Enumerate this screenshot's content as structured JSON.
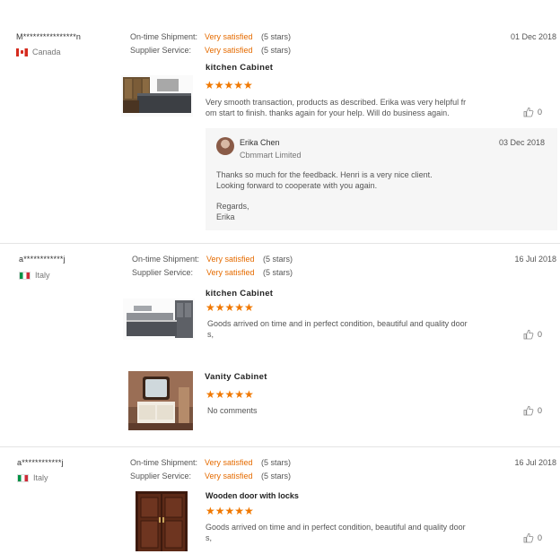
{
  "reviews": [
    {
      "user": "M****************n",
      "country": "Canada",
      "shipment_label": "On-time Shipment:",
      "shipment_value": "Very satisfied",
      "shipment_stars": "(5 stars)",
      "service_label": "Supplier Service:",
      "service_value": "Very satisfied",
      "service_stars": "(5 stars)",
      "date": "01 Dec 2018",
      "items": [
        {
          "title": "kitchen Cabinet",
          "stars": "★★★★★",
          "text_line1": "Very smooth transaction, products as described. Erika was very helpful fr",
          "text_line2": "om start to finish. thanks again for your help. Will do business again.",
          "likes": "0"
        }
      ],
      "reply": {
        "name": "Erika Chen",
        "company": "Cbmmart Limited",
        "date": "03 Dec 2018",
        "line1": "Thanks so much for the feedback. Henri is a very nice client.",
        "line2": "Looking forward to cooperate with you again.",
        "line3": "Regards,",
        "line4": "Erika"
      }
    },
    {
      "user": "a************j",
      "country": "Italy",
      "shipment_label": "On-time Shipment:",
      "shipment_value": "Very satisfied",
      "shipment_stars": "(5 stars)",
      "service_label": "Supplier Service:",
      "service_value": "Very satisfied",
      "service_stars": "(5 stars)",
      "date": "16 Jul 2018",
      "items": [
        {
          "title": "kitchen Cabinet",
          "stars": "★★★★★",
          "text_line1": "Goods arrived on time and in perfect condition, beautiful and quality door",
          "text_line2": "s,",
          "likes": "0"
        },
        {
          "title": "Vanity Cabinet",
          "stars": "★★★★★",
          "text_line1": "No comments",
          "likes": "0"
        }
      ]
    },
    {
      "user": "a************j",
      "country": "Italy",
      "shipment_label": "On-time Shipment:",
      "shipment_value": "Very satisfied",
      "shipment_stars": "(5 stars)",
      "service_label": "Supplier Service:",
      "service_value": "Very satisfied",
      "service_stars": "(5 stars)",
      "date": "16 Jul 2018",
      "items": [
        {
          "title": "Wooden door with locks",
          "stars": "★★★★★",
          "text_line1": "Goods arrived on time and in perfect condition, beautiful and quality door",
          "text_line2": "s,",
          "likes": "0"
        }
      ]
    }
  ],
  "colors": {
    "accent": "#e56b00",
    "star": "#f07800",
    "reply_bg": "#f6f6f6"
  },
  "icons": {
    "like": "thumbs-up-icon"
  }
}
